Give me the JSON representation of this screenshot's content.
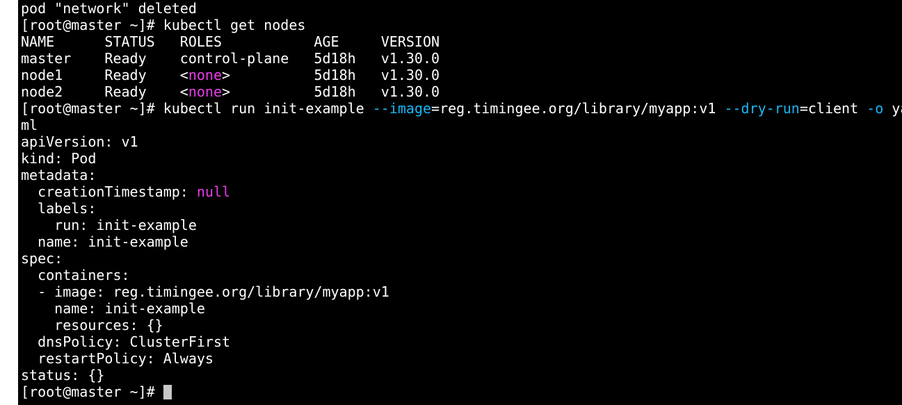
{
  "colors": {
    "background": "#000000",
    "default": "#ffffff",
    "cyan": "#18b6f5",
    "magenta": "#e83ee8",
    "cursor": "#c8c8c8"
  },
  "lines": [
    [
      {
        "t": "pod \"network\" deleted"
      }
    ],
    [
      {
        "t": "[root@master ~]# kubectl get nodes"
      }
    ],
    [
      {
        "t": "NAME      STATUS   ROLES           AGE     VERSION"
      }
    ],
    [
      {
        "t": "master    Ready    control-plane   5d18h   v1.30.0"
      }
    ],
    [
      {
        "t": "node1     Ready    <"
      },
      {
        "t": "none",
        "c": "magenta"
      },
      {
        "t": ">          5d18h   v1.30.0"
      }
    ],
    [
      {
        "t": "node2     Ready    <"
      },
      {
        "t": "none",
        "c": "magenta"
      },
      {
        "t": ">          5d18h   v1.30.0"
      }
    ],
    [
      {
        "t": "[root@master ~]# kubectl run init-example "
      },
      {
        "t": "--image",
        "c": "cyan"
      },
      {
        "t": "=reg.timingee.org/library/myapp:v1 "
      },
      {
        "t": "--dry-run",
        "c": "cyan"
      },
      {
        "t": "=client "
      },
      {
        "t": "-o",
        "c": "cyan"
      },
      {
        "t": " ya"
      }
    ],
    [
      {
        "t": "ml"
      }
    ],
    [
      {
        "t": "apiVersion: v1"
      }
    ],
    [
      {
        "t": "kind: Pod"
      }
    ],
    [
      {
        "t": "metadata:"
      }
    ],
    [
      {
        "t": "  creationTimestamp: "
      },
      {
        "t": "null",
        "c": "magenta"
      }
    ],
    [
      {
        "t": "  labels:"
      }
    ],
    [
      {
        "t": "    run: init-example"
      }
    ],
    [
      {
        "t": "  name: init-example"
      }
    ],
    [
      {
        "t": "spec:"
      }
    ],
    [
      {
        "t": "  containers:"
      }
    ],
    [
      {
        "t": "  - image: reg.timingee.org/library/myapp:v1"
      }
    ],
    [
      {
        "t": "    name: init-example"
      }
    ],
    [
      {
        "t": "    resources: {}"
      }
    ],
    [
      {
        "t": "  dnsPolicy: ClusterFirst"
      }
    ],
    [
      {
        "t": "  restartPolicy: Always"
      }
    ],
    [
      {
        "t": "status: {}"
      }
    ],
    [
      {
        "t": "[root@master ~]# "
      },
      {
        "cursor": true
      }
    ]
  ]
}
